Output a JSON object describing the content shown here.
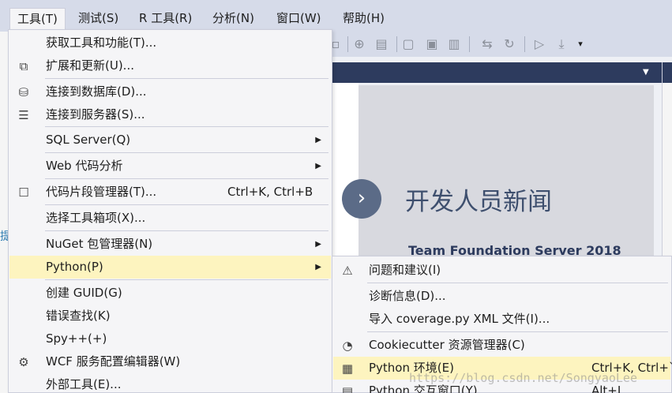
{
  "menubar": {
    "items": [
      {
        "label": "工具(T)"
      },
      {
        "label": "测试(S)"
      },
      {
        "label": "R 工具(R)"
      },
      {
        "label": "分析(N)"
      },
      {
        "label": "窗口(W)"
      },
      {
        "label": "帮助(H)"
      }
    ]
  },
  "tools_menu": {
    "items": [
      {
        "label": "获取工具和功能(T)...",
        "icon": "none"
      },
      {
        "label": "扩展和更新(U)...",
        "icon": "extensions-icon"
      },
      {
        "label": "连接到数据库(D)...",
        "icon": "database-connect-icon"
      },
      {
        "label": "连接到服务器(S)...",
        "icon": "server-connect-icon"
      },
      {
        "label": "SQL Server(Q)",
        "icon": "none"
      },
      {
        "label": "Web 代码分析",
        "icon": "none"
      },
      {
        "label": "代码片段管理器(T)...",
        "shortcut": "Ctrl+K, Ctrl+B",
        "icon": "snippet-icon"
      },
      {
        "label": "选择工具箱项(X)...",
        "icon": "none"
      },
      {
        "label": "NuGet 包管理器(N)",
        "icon": "none"
      },
      {
        "label": "Python(P)",
        "icon": "none"
      },
      {
        "label": "创建 GUID(G)",
        "icon": "none"
      },
      {
        "label": "错误查找(K)",
        "icon": "none"
      },
      {
        "label": "Spy++(+)",
        "icon": "none"
      },
      {
        "label": "WCF 服务配置编辑器(W)",
        "icon": "wcf-gear-icon"
      },
      {
        "label": "外部工具(E)...",
        "icon": "none"
      }
    ]
  },
  "python_submenu": {
    "items": [
      {
        "label": "问题和建议(I)",
        "icon": "feedback-icon"
      },
      {
        "label": "诊断信息(D)...",
        "icon": "none"
      },
      {
        "label": "导入 coverage.py XML 文件(I)...",
        "icon": "none"
      },
      {
        "label": "Cookiecutter 资源管理器(C)",
        "icon": "cookie-icon"
      },
      {
        "label": "Python 环境(E)",
        "shortcut": "Ctrl+K, Ctrl+`",
        "icon": "python-environment-icon"
      },
      {
        "label": "Python 交互窗口(Y)",
        "shortcut": "Alt+I",
        "icon": "python-interactive-icon"
      }
    ]
  },
  "start_page": {
    "news_title": "开发人员新闻",
    "news_subtitle": "Team Foundation Server 2018",
    "left_glyph": "提"
  },
  "watermark": "https://blog.csdn.net/SongyaoLee",
  "colors": {
    "menubar_bg": "#d6dbe9",
    "menu_bg": "#f5f5f7",
    "highlight": "#fdf4bf",
    "tabstrip": "#2d3b5e",
    "news_title": "#3e4f6e"
  }
}
